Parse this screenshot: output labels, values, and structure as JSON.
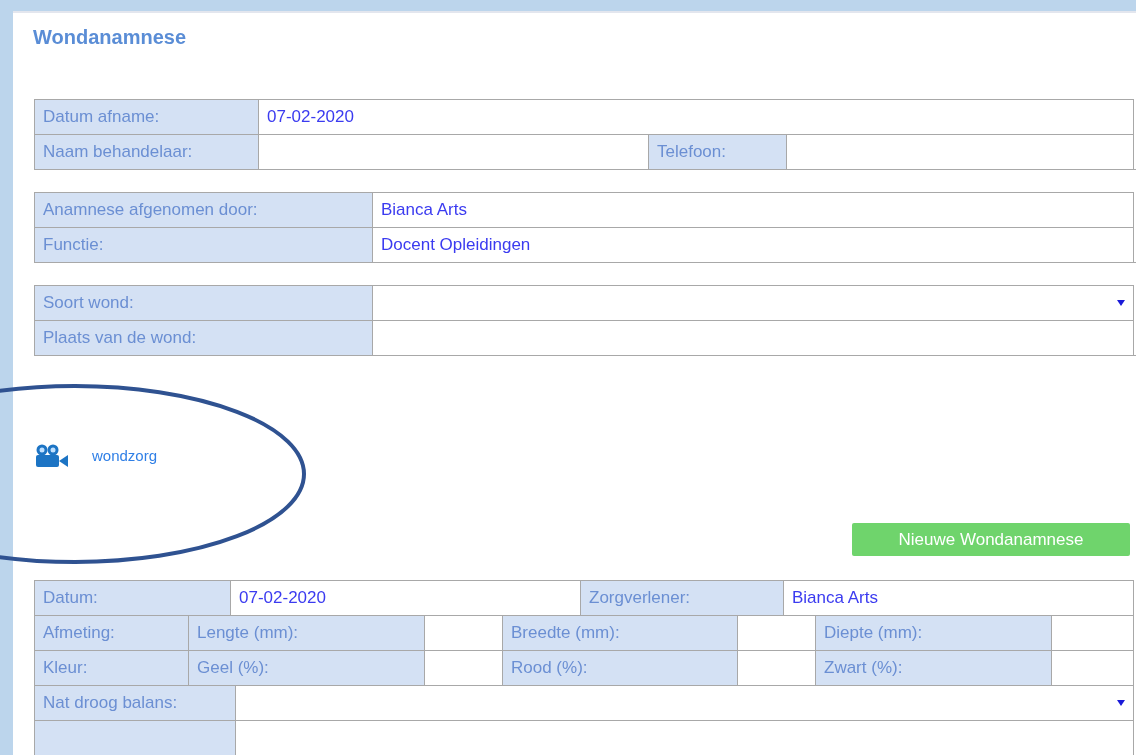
{
  "title": "Wondanamnese",
  "tables": [
    {
      "rows": [
        [
          {
            "kind": "label",
            "text": "Datum afname:"
          },
          {
            "kind": "value",
            "text": "07-02-2020"
          }
        ],
        [
          {
            "kind": "label",
            "text": "Naam behandelaar:"
          },
          {
            "kind": "value"
          },
          {
            "kind": "label",
            "text": "Telefoon:"
          },
          {
            "kind": "value"
          }
        ]
      ]
    },
    {
      "rows": [
        [
          {
            "kind": "label",
            "text": "Anamnese afgenomen door:"
          },
          {
            "kind": "value",
            "text": "Bianca Arts"
          }
        ],
        [
          {
            "kind": "label",
            "text": "Functie:"
          },
          {
            "kind": "value",
            "text": "Docent Opleidingen"
          }
        ]
      ]
    },
    {
      "rows": [
        [
          {
            "kind": "label",
            "text": "Soort wond:"
          },
          {
            "kind": "select"
          }
        ],
        [
          {
            "kind": "label",
            "text": "Plaats van de wond:"
          },
          {
            "kind": "value"
          }
        ]
      ]
    }
  ],
  "video_link": {
    "text": "wondzorg"
  },
  "new_button": "Nieuwe Wondanamnese",
  "record": {
    "summary": [
      [
        {
          "kind": "label",
          "text": "Datum:"
        },
        {
          "kind": "value",
          "text": "07-02-2020"
        },
        {
          "kind": "label",
          "text": "Zorgverlener:"
        },
        {
          "kind": "value",
          "text": "Bianca Arts"
        }
      ]
    ],
    "measurements": [
      [
        {
          "kind": "label",
          "text": "Afmeting:"
        },
        {
          "kind": "label",
          "text": "Lengte (mm):"
        },
        {
          "kind": "value"
        },
        {
          "kind": "label",
          "text": "Breedte (mm):"
        },
        {
          "kind": "value"
        },
        {
          "kind": "label",
          "text": "Diepte (mm):"
        },
        {
          "kind": "value"
        }
      ],
      [
        {
          "kind": "label",
          "text": "Kleur:"
        },
        {
          "kind": "label",
          "text": "Geel (%):"
        },
        {
          "kind": "value"
        },
        {
          "kind": "label",
          "text": "Rood (%):"
        },
        {
          "kind": "value"
        },
        {
          "kind": "label",
          "text": "Zwart (%):"
        },
        {
          "kind": "value"
        }
      ]
    ],
    "balance": [
      [
        {
          "kind": "label",
          "text": "Nat droog balans:"
        },
        {
          "kind": "select"
        }
      ],
      [
        {
          "kind": "label"
        },
        {
          "kind": "value"
        }
      ]
    ]
  }
}
